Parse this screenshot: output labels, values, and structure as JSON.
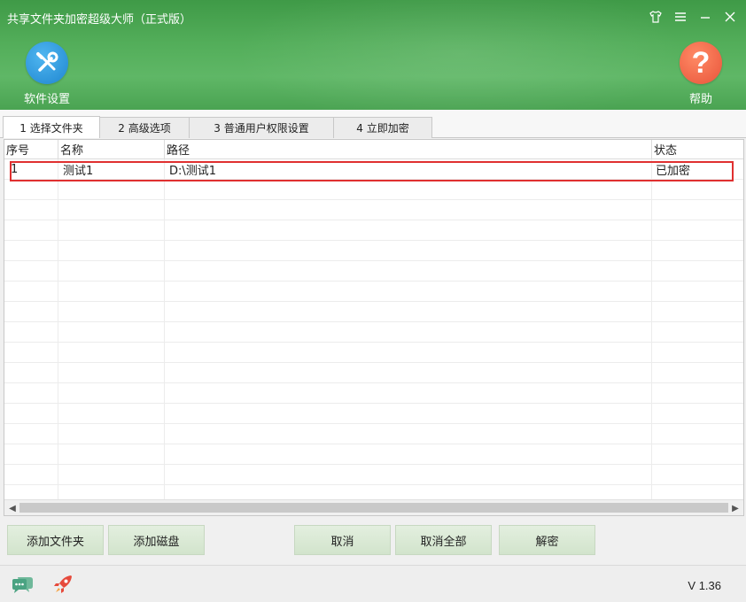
{
  "window": {
    "title": "共享文件夹加密超级大师（正式版）",
    "controls": [
      "shirt-icon",
      "menu-icon",
      "minimize-icon",
      "close-icon"
    ]
  },
  "toolbar": {
    "settings_label": "软件设置",
    "help_label": "帮助",
    "settings_color": "#2a95dc",
    "help_color": "#f06a4c"
  },
  "tabs": [
    {
      "label": "1 选择文件夹",
      "active": true
    },
    {
      "label": "2 高级选项",
      "active": false
    },
    {
      "label": "3 普通用户权限设置",
      "active": false
    },
    {
      "label": "4 立即加密",
      "active": false
    }
  ],
  "table": {
    "columns": [
      "序号",
      "名称",
      "路径",
      "状态"
    ],
    "rows": [
      {
        "index": "1",
        "name": "测试1",
        "path": "D:\\测试1",
        "status": "已加密"
      }
    ],
    "highlight_color": "#e03030"
  },
  "buttons": {
    "add_folder": "添加文件夹",
    "add_disk": "添加磁盘",
    "cancel": "取消",
    "cancel_all": "取消全部",
    "decrypt": "解密"
  },
  "footer": {
    "version": "V 1.36"
  }
}
